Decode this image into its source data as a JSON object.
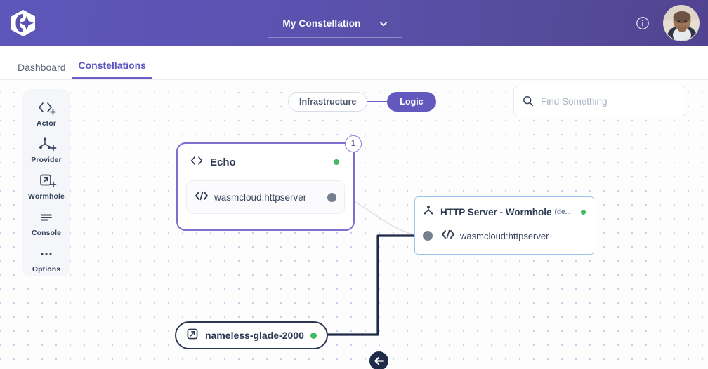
{
  "header": {
    "logo_icon": "constellation-hexagon-logo",
    "title": "My Constellation",
    "chevron_icon": "chevron-down-icon",
    "info_icon": "info-circle-icon",
    "avatar_icon": "user-avatar"
  },
  "nav": {
    "tabs": [
      {
        "label": "Dashboard",
        "active": false
      },
      {
        "label": "Constellations",
        "active": true
      }
    ]
  },
  "toolbar": {
    "items": [
      {
        "label": "Actor",
        "icon": "code-brackets-plus-icon"
      },
      {
        "label": "Provider",
        "icon": "node-graph-plus-icon"
      },
      {
        "label": "Wormhole",
        "icon": "wormhole-box-plus-icon"
      },
      {
        "label": "Console",
        "icon": "console-lines-icon"
      },
      {
        "label": "Options",
        "icon": "ellipsis-icon"
      }
    ]
  },
  "filter": {
    "infrastructure_label": "Infrastructure",
    "logic_label": "Logic",
    "selected": "Logic"
  },
  "search": {
    "placeholder": "Find Something",
    "value": "",
    "icon": "search-icon"
  },
  "canvas": {
    "nodes": [
      {
        "id": "echo",
        "type": "actor",
        "title": "Echo",
        "icon": "code-brackets-icon",
        "status": "running",
        "badge": "1",
        "selected": true,
        "ports": [
          {
            "label": "wasmcloud:httpserver",
            "icon": "code-slash-icon",
            "side": "right"
          }
        ]
      },
      {
        "id": "http-server",
        "type": "provider",
        "title": "HTTP Server - Wormhole",
        "title_suffix": "(de...",
        "icon": "node-graph-icon",
        "status": "running",
        "selected": true,
        "ports": [
          {
            "label": "wasmcloud:httpserver",
            "icon": "code-slash-icon",
            "side": "left"
          }
        ]
      },
      {
        "id": "nameless-glade-2000",
        "type": "wormhole",
        "title": "nameless-glade-2000",
        "icon": "wormhole-box-icon",
        "status": "running"
      }
    ],
    "edges": [
      {
        "from": "nameless-glade-2000",
        "to": "http-server",
        "style": "solid-dark",
        "arrow_icon": "arrow-left-icon"
      },
      {
        "from": "echo",
        "to": "http-server",
        "style": "faint-curve"
      }
    ]
  },
  "colors": {
    "brand_purple": "#6258bd",
    "header_purple": "#5d57ba",
    "status_green": "#43b85c",
    "edge_navy": "#1e2a47",
    "selected_blue": "#9cc4ef",
    "grid_dot": "#c6d2ec"
  }
}
